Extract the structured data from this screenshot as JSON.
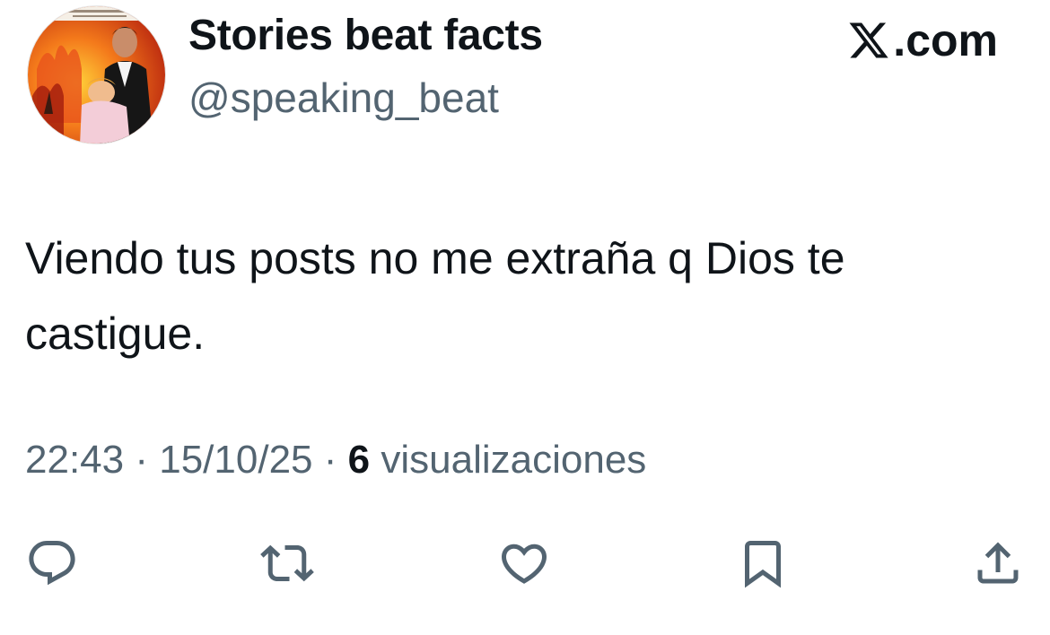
{
  "author": {
    "display_name": "Stories beat facts",
    "handle": "@speaking_beat",
    "avatar_icon": "movie-poster-avatar"
  },
  "brand": {
    "label": ".com",
    "icon": "x-logo-icon"
  },
  "tweet": {
    "text_line1": "Viendo tus posts no me extraña q Dios te",
    "text_line2": "castigue."
  },
  "meta": {
    "time": "22:43",
    "separator": "·",
    "date": "15/10/25",
    "views_count": "6",
    "views_label": "visualizaciones"
  },
  "actions": {
    "icons": [
      "reply-icon",
      "retweet-icon",
      "like-icon",
      "bookmark-icon",
      "share-icon"
    ]
  },
  "colors": {
    "text_primary": "#0f1419",
    "text_secondary": "#536471",
    "background": "#ffffff"
  }
}
